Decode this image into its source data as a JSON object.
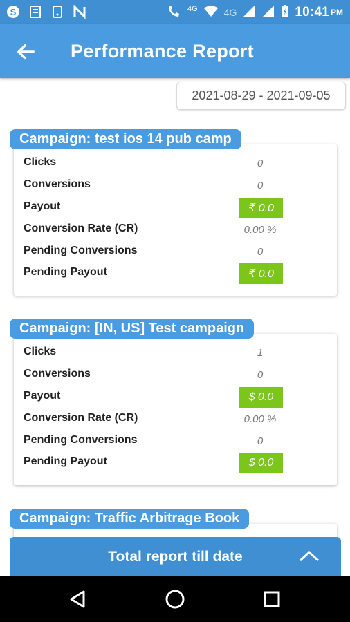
{
  "status_bar": {
    "time": "10:41",
    "ampm": "PM",
    "network_label": "4G",
    "network_label_small": "4G",
    "app_icons": [
      "skype-icon",
      "news-icon",
      "phone-app-icon",
      "n-app-icon"
    ]
  },
  "header": {
    "title": "Performance Report"
  },
  "date_range": "2021-08-29 - 2021-09-05",
  "campaigns": [
    {
      "title": "Campaign: test ios 14 pub camp",
      "rows": [
        {
          "label": "Clicks",
          "value": "0"
        },
        {
          "label": "Conversions",
          "value": "0"
        },
        {
          "label": "Payout",
          "value": "₹ 0.0"
        },
        {
          "label": "Conversion Rate (CR)",
          "value": "0.00 %"
        },
        {
          "label": "Pending Conversions",
          "value": "0"
        },
        {
          "label": "Pending Payout",
          "value": "₹ 0.0"
        }
      ]
    },
    {
      "title": "Campaign: [IN, US] Test campaign",
      "rows": [
        {
          "label": "Clicks",
          "value": "1"
        },
        {
          "label": "Conversions",
          "value": "0"
        },
        {
          "label": "Payout",
          "value": "$ 0.0"
        },
        {
          "label": "Conversion Rate (CR)",
          "value": "0.00 %"
        },
        {
          "label": "Pending Conversions",
          "value": "0"
        },
        {
          "label": "Pending Payout",
          "value": "$ 0.0"
        }
      ]
    },
    {
      "title": "Campaign: Traffic Arbitrage Book"
    }
  ],
  "bottom_panel": {
    "label": "Total report till date"
  },
  "colors": {
    "primary": "#4a9be0",
    "money_badge": "#7cc51a"
  }
}
